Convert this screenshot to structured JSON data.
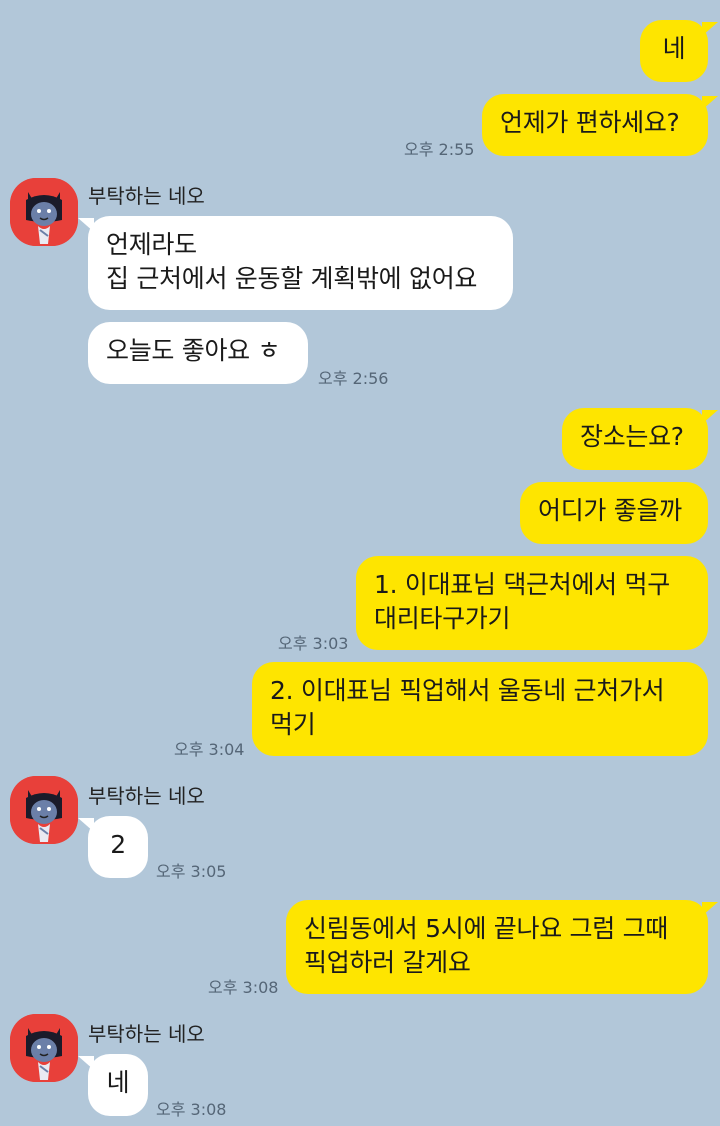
{
  "colors": {
    "background": "#b2c7d9",
    "my_bubble": "#fee500",
    "other_bubble": "#ffffff",
    "avatar_bg": "#e8403a"
  },
  "sender_name": "부탁하는 네오",
  "messages": [
    {
      "from": "me",
      "text": "네"
    },
    {
      "from": "me",
      "text": "언제가 편하세요?",
      "time": "오후 2:55"
    },
    {
      "from": "other",
      "text": "언제라도\n집 근처에서 운동할 계획밖에 없어요"
    },
    {
      "from": "other",
      "text": "오늘도 좋아요 ㅎ",
      "time": "오후 2:56"
    },
    {
      "from": "me",
      "text": "장소는요?"
    },
    {
      "from": "me",
      "text": "어디가 좋을까"
    },
    {
      "from": "me",
      "text": "1. 이대표님 댁근처에서 먹구\n대리타구가기",
      "time": "오후 3:03"
    },
    {
      "from": "me",
      "text": "2. 이대표님 픽업해서 울동네 근처가서\n먹기",
      "time": "오후 3:04"
    },
    {
      "from": "other",
      "text": "2",
      "time": "오후 3:05"
    },
    {
      "from": "me",
      "text": "신림동에서 5시에 끝나요 그럼 그때\n픽업하러 갈게요",
      "time": "오후 3:08"
    },
    {
      "from": "other",
      "text": "네",
      "time": "오후 3:08"
    }
  ]
}
